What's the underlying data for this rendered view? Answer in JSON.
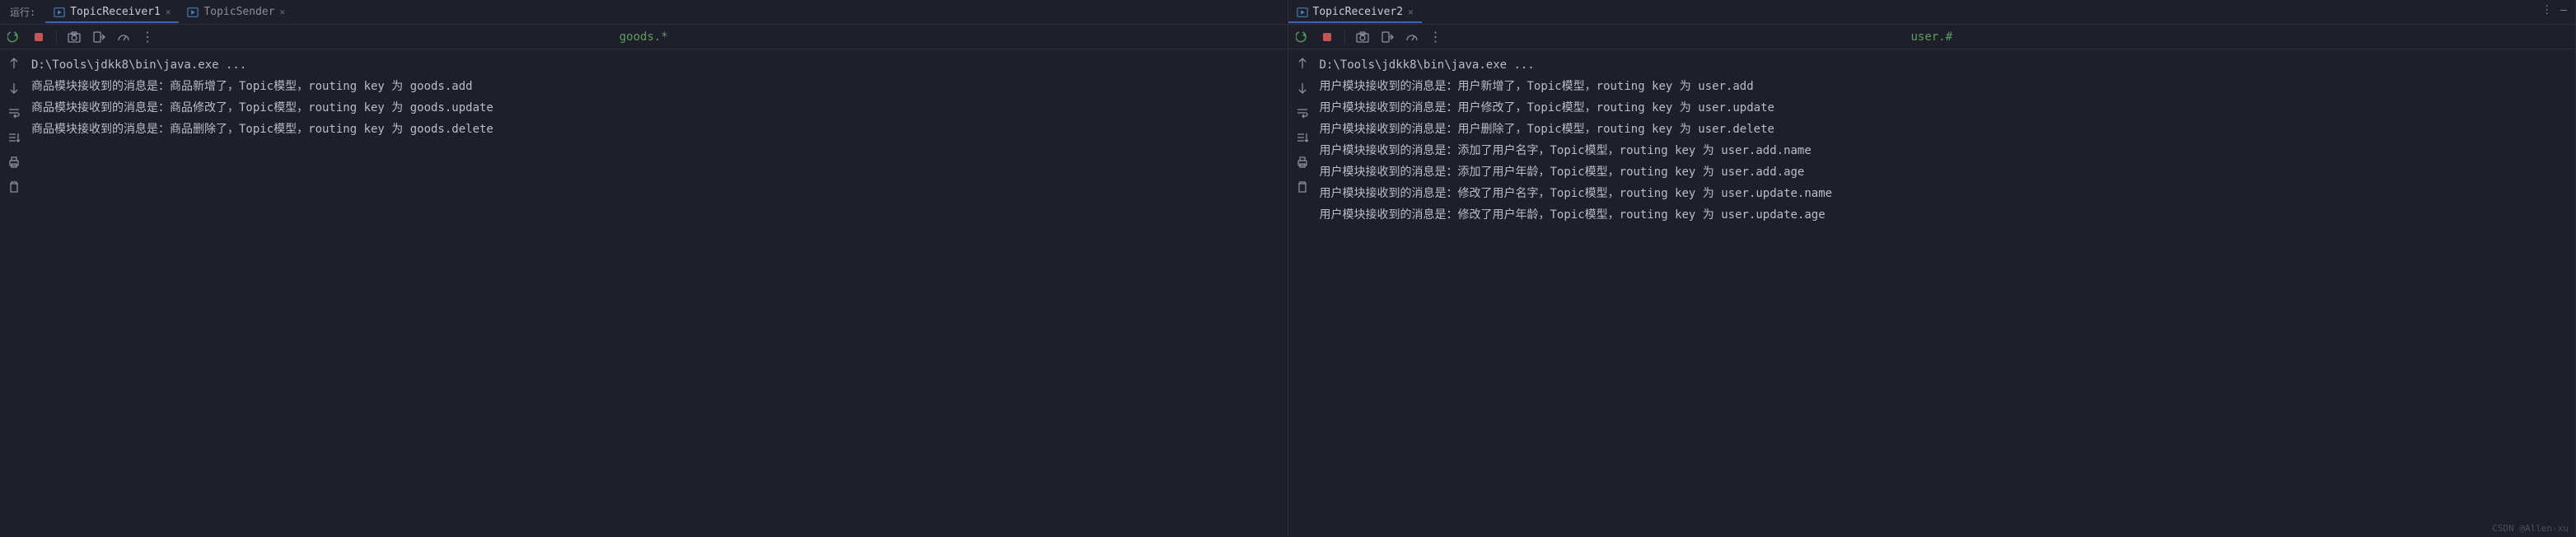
{
  "run_label": "运行:",
  "top_right": {
    "more": "⋮",
    "minimize": "—"
  },
  "panel1": {
    "tabs": [
      {
        "label": "TopicReceiver1",
        "active": true
      },
      {
        "label": "TopicSender",
        "active": false
      }
    ],
    "pattern": "goods.*",
    "lines": [
      "D:\\Tools\\jdkk8\\bin\\java.exe ...",
      "商品模块接收到的消息是：商品新增了，Topic模型，routing key 为 goods.add",
      "商品模块接收到的消息是：商品修改了，Topic模型，routing key 为 goods.update",
      "商品模块接收到的消息是：商品删除了，Topic模型，routing key 为 goods.delete"
    ]
  },
  "panel2": {
    "tabs": [
      {
        "label": "TopicReceiver2",
        "active": true
      }
    ],
    "pattern": "user.#",
    "lines": [
      "D:\\Tools\\jdkk8\\bin\\java.exe ...",
      "用户模块接收到的消息是：用户新增了，Topic模型，routing key 为 user.add",
      "用户模块接收到的消息是：用户修改了，Topic模型，routing key 为 user.update",
      "用户模块接收到的消息是：用户删除了，Topic模型，routing key 为 user.delete",
      "用户模块接收到的消息是：添加了用户名字，Topic模型，routing key 为 user.add.name",
      "用户模块接收到的消息是：添加了用户年龄，Topic模型，routing key 为 user.add.age",
      "用户模块接收到的消息是：修改了用户名字，Topic模型，routing key 为 user.update.name",
      "用户模块接收到的消息是：修改了用户年龄，Topic模型，routing key 为 user.update.age"
    ]
  },
  "watermark": "CSDN @Allen-xu"
}
